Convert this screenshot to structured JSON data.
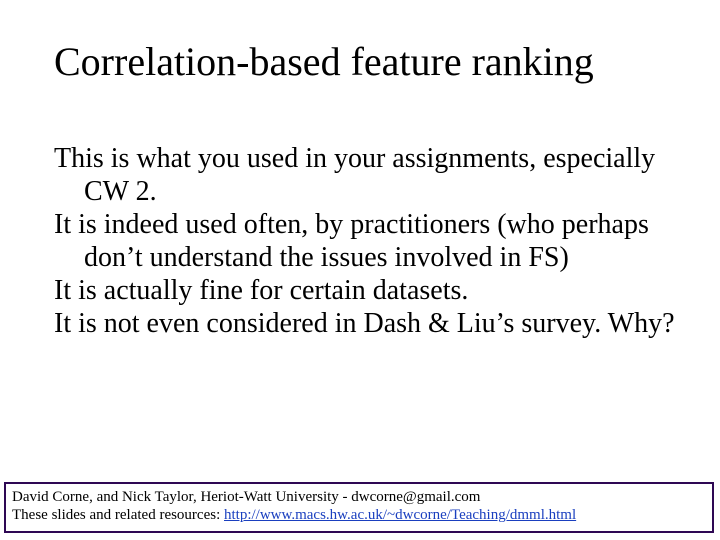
{
  "title": "Correlation-based feature ranking",
  "body": {
    "p1": "This is what you used in your assignments, especially CW 2.",
    "p2": "It is indeed used often, by practitioners (who perhaps don’t understand the issues involved in FS)",
    "p3": "It is actually fine for certain datasets.",
    "p4": "It is not even considered in Dash & Liu’s survey.  Why?"
  },
  "footer": {
    "line1": "David Corne, and Nick Taylor,  Heriot-Watt University  -  dwcorne@gmail.com",
    "line2_label": "These slides and related resources:  ",
    "line2_link": "http://www.macs.hw.ac.uk/~dwcorne/Teaching/dmml.html"
  }
}
